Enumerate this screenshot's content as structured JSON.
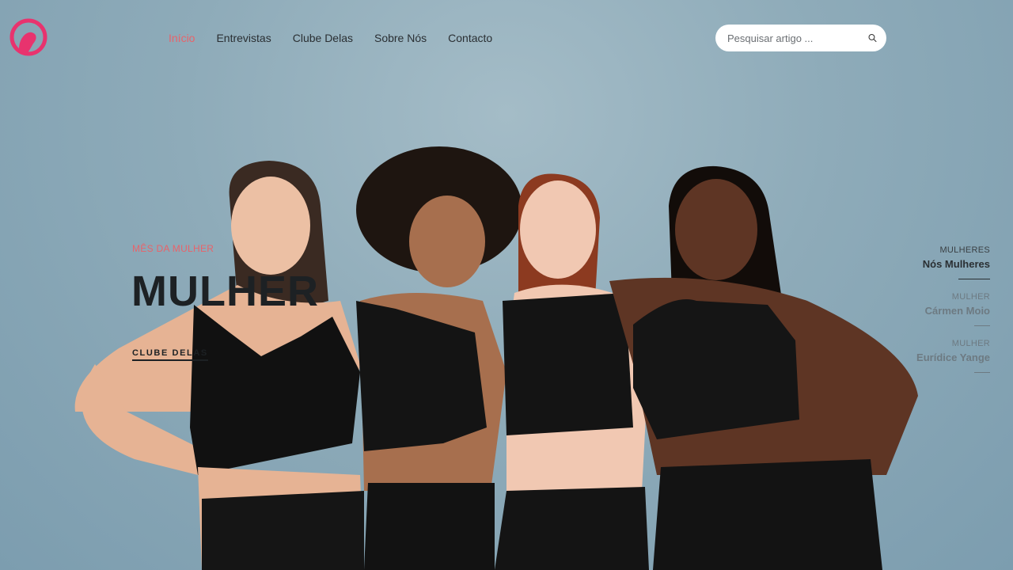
{
  "brand": {
    "logo_icon": "woman-head-silhouette-icon",
    "color": "#e8336e"
  },
  "nav": [
    {
      "label": "Início",
      "active": true
    },
    {
      "label": "Entrevistas",
      "active": false
    },
    {
      "label": "Clube Delas",
      "active": false
    },
    {
      "label": "Sobre Nós",
      "active": false
    },
    {
      "label": "Contacto",
      "active": false
    }
  ],
  "search": {
    "placeholder": "Pesquisar artigo ...",
    "icon": "search-icon"
  },
  "hero": {
    "kicker": "MÊS DA MULHER",
    "title": "MULHER",
    "cta_label": "CLUBE DELAS",
    "accent_color": "#e8636a"
  },
  "slides": [
    {
      "category": "MULHERES",
      "title": "Nós Mulheres",
      "active": true
    },
    {
      "category": "MULHER",
      "title": "Cármen Moio",
      "active": false
    },
    {
      "category": "MULHER",
      "title": "Eurídice Yange",
      "active": false
    }
  ]
}
